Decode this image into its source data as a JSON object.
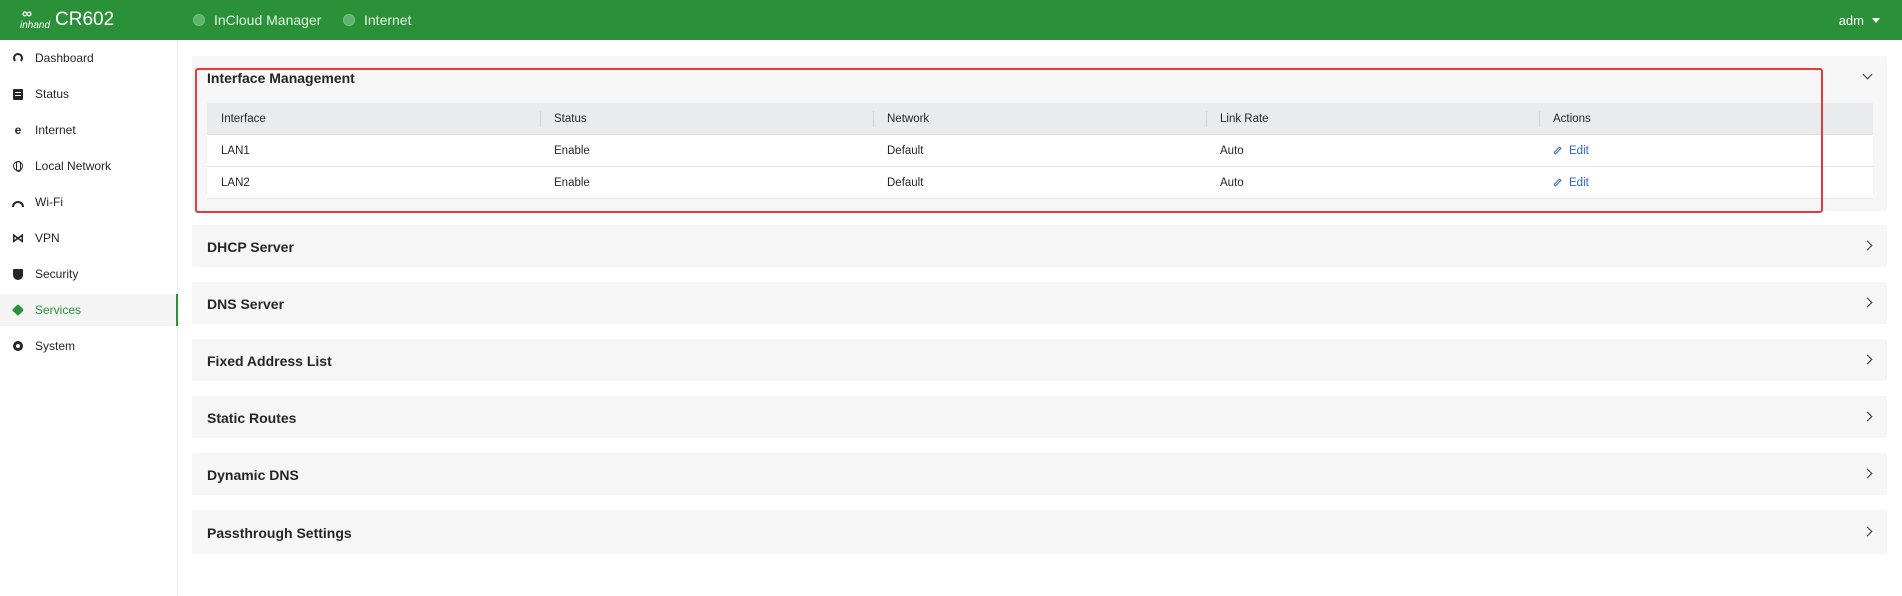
{
  "header": {
    "brand": "inhand",
    "model": "CR602",
    "nav": [
      {
        "label": "InCloud Manager"
      },
      {
        "label": "Internet"
      }
    ],
    "user": "adm"
  },
  "sidebar": {
    "items": [
      {
        "label": "Dashboard",
        "icon": "dashboard-icon"
      },
      {
        "label": "Status",
        "icon": "status-icon"
      },
      {
        "label": "Internet",
        "icon": "internet-icon"
      },
      {
        "label": "Local Network",
        "icon": "globe-icon"
      },
      {
        "label": "Wi-Fi",
        "icon": "wifi-icon"
      },
      {
        "label": "VPN",
        "icon": "vpn-icon"
      },
      {
        "label": "Security",
        "icon": "shield-icon"
      },
      {
        "label": "Services",
        "icon": "cube-icon",
        "active": true
      },
      {
        "label": "System",
        "icon": "gear-icon"
      }
    ]
  },
  "main": {
    "interface_management": {
      "title": "Interface Management",
      "columns": [
        "Interface",
        "Status",
        "Network",
        "Link Rate",
        "Actions"
      ],
      "rows": [
        {
          "interface": "LAN1",
          "status": "Enable",
          "network": "Default",
          "link_rate": "Auto",
          "action": "Edit"
        },
        {
          "interface": "LAN2",
          "status": "Enable",
          "network": "Default",
          "link_rate": "Auto",
          "action": "Edit"
        }
      ]
    },
    "sections": [
      {
        "title": "DHCP Server"
      },
      {
        "title": "DNS Server"
      },
      {
        "title": "Fixed Address List"
      },
      {
        "title": "Static Routes"
      },
      {
        "title": "Dynamic DNS"
      },
      {
        "title": "Passthrough Settings"
      }
    ]
  },
  "colors": {
    "brand_green": "#2a9138",
    "highlight_red": "#e33b3b",
    "link_blue": "#2a66c9"
  }
}
